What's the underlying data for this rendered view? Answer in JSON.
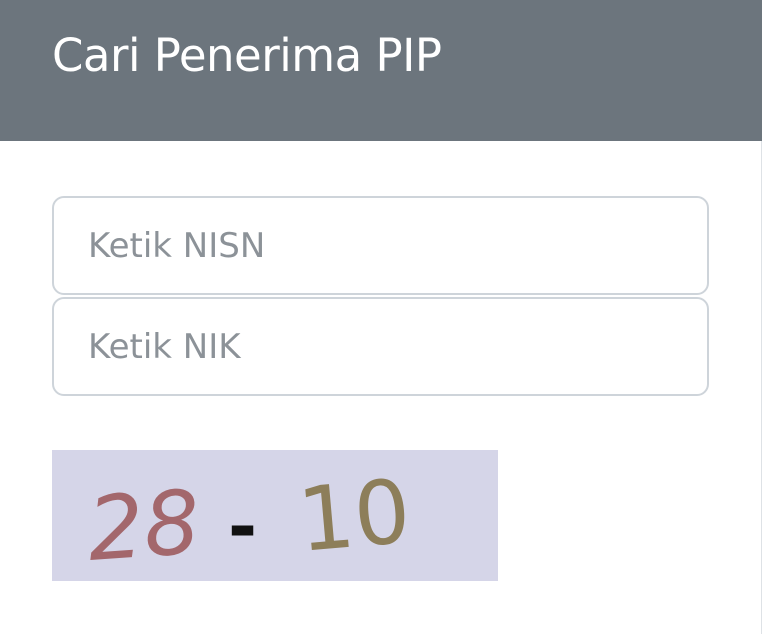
{
  "header": {
    "title": "Cari Penerima PIP"
  },
  "form": {
    "nisn_placeholder": "Ketik NISN",
    "nisn_value": "",
    "nik_placeholder": "Ketik NIK",
    "nik_value": ""
  },
  "captcha": {
    "part1": "28",
    "part2": "-",
    "part3": "10",
    "background_color": "#d5d5e8",
    "color1": "#a3676c",
    "color2": "#111111",
    "color3": "#8d7e5a"
  }
}
